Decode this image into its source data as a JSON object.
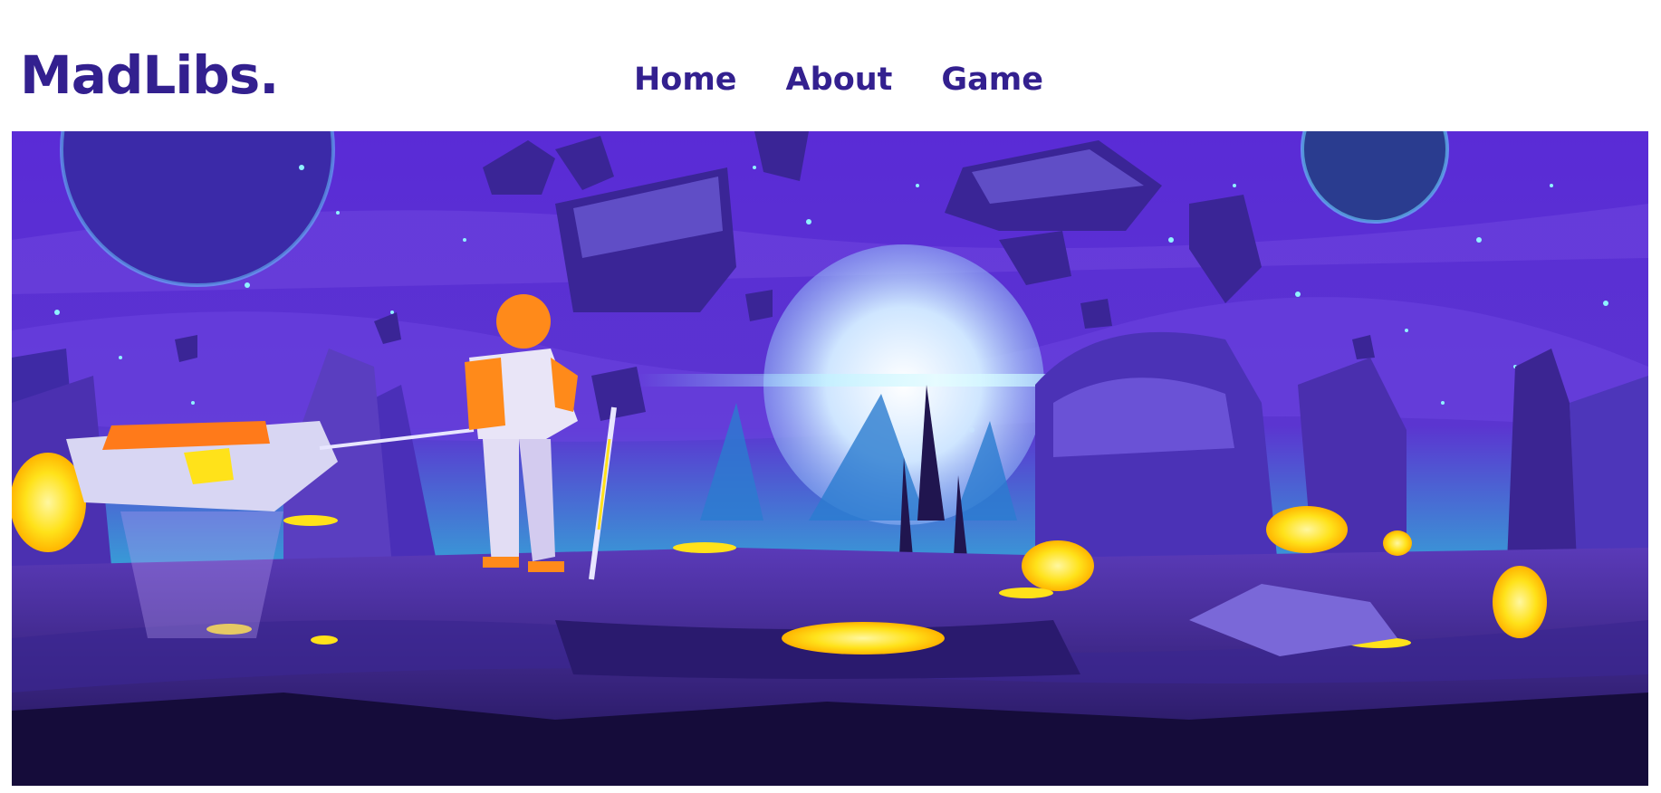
{
  "header": {
    "logo": "MadLibs."
  },
  "nav": {
    "items": [
      {
        "label": "Home"
      },
      {
        "label": "About"
      },
      {
        "label": "Game"
      }
    ]
  },
  "colors": {
    "brand": "#33208f",
    "sky_top": "#5a2bd6",
    "sky_bottom": "#2fb6d8",
    "glow": "#ffe21a"
  },
  "hero": {
    "icon": "alien-landscape-illustration"
  }
}
